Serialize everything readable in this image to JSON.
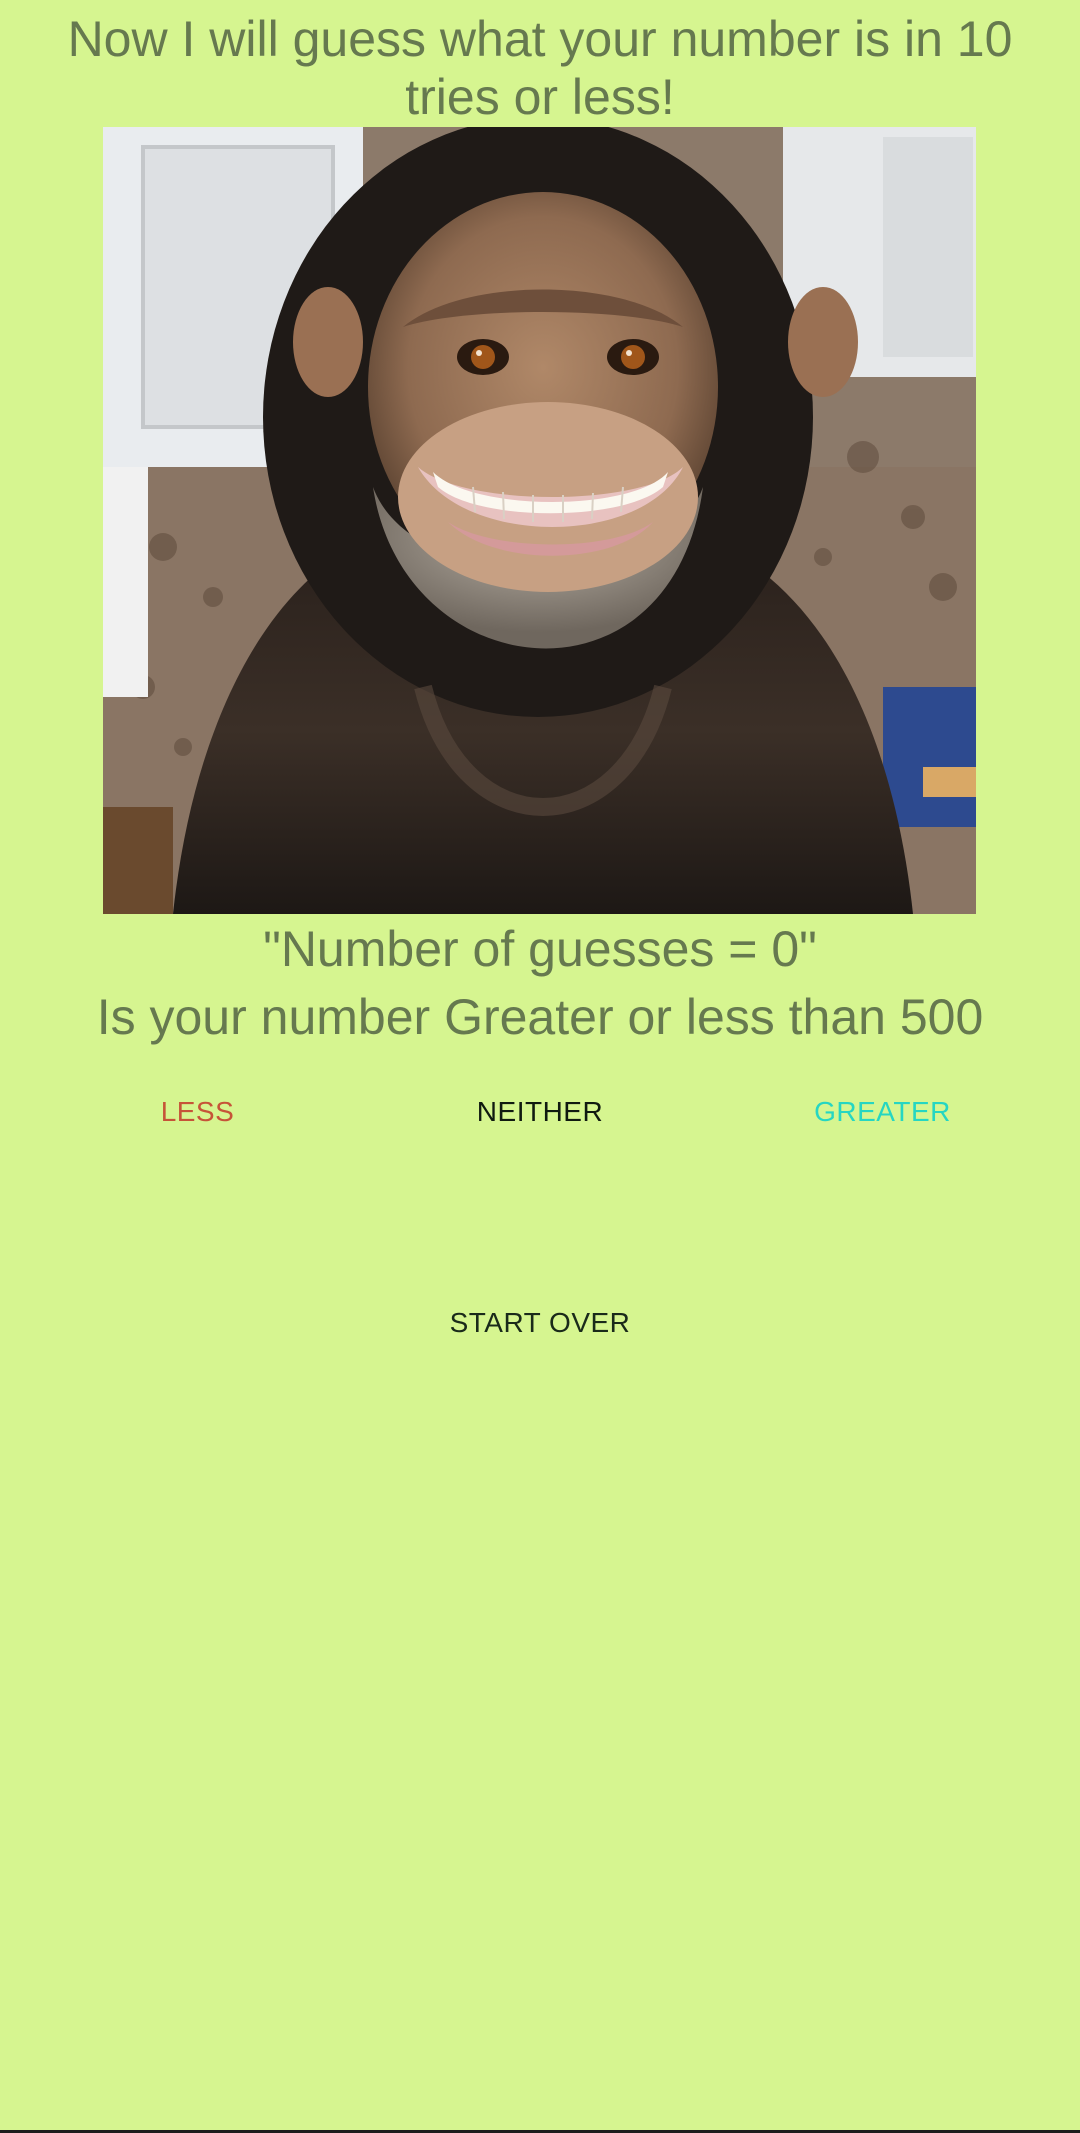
{
  "header": {
    "title": "Now I will guess what your number is in 10 tries or less!"
  },
  "game": {
    "guess_count_text": "\"Number of guesses = 0\"",
    "question_text": "Is your number Greater or less than 500"
  },
  "buttons": {
    "less_label": "LESS",
    "neither_label": "NEITHER",
    "greater_label": "GREATER",
    "start_over_label": "START OVER"
  },
  "colors": {
    "background": "#d6f590",
    "text_primary": "#66794f",
    "less": "#c65438",
    "neither": "#101a10",
    "greater": "#26d6c2"
  }
}
